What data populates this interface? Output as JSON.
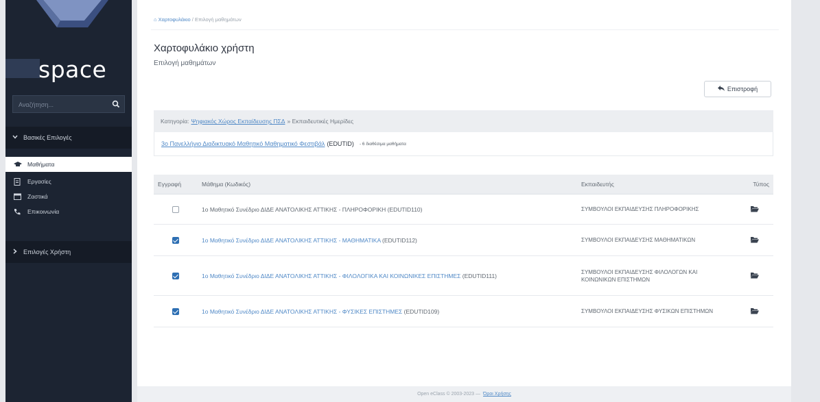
{
  "sidebar": {
    "logo_text": "space",
    "search_placeholder": "Αναζήτηση...",
    "section_basic": "Βασικές Επιλογές",
    "items": [
      {
        "label": "Μαθήματα",
        "icon": "graduation-cap-icon",
        "active": true
      },
      {
        "label": "Εργασίες",
        "icon": "file-icon",
        "active": false
      },
      {
        "label": "Ζαστικά",
        "icon": "calendar-icon",
        "active": false
      },
      {
        "label": "Επικοινωνία",
        "icon": "phone-icon",
        "active": false
      }
    ],
    "section_user": "Επιλογές Χρήστη"
  },
  "breadcrumb": {
    "home": "Χαρτοφυλάκιο",
    "separator": "/",
    "current": "Επιλογή μαθημάτων"
  },
  "page": {
    "title": "Χαρτοφυλάκιο χρήστη",
    "subtitle": "Επιλογή μαθημάτων",
    "back_label": "Επιστροφή"
  },
  "category": {
    "prefix": "Κατηγορία:",
    "link": "Ψηφιακός Χώρος Εκπαίδευσης ΠΣΔ",
    "suffix": "» Εκπαιδευτικές Ημερίδες"
  },
  "course_group": {
    "title": "3ο Πανελλήνιο Διαδικτυακό Μαθητικό Μαθηματικό Φεστιβάλ",
    "code": "(EDUTID)",
    "count": "- 6 διαθέσιμα μαθήματα"
  },
  "table": {
    "headers": [
      "Εγγραφή",
      "Μάθημα (Κωδικός)",
      "Εκπαιδευτής",
      "Τύπος"
    ],
    "rows": [
      {
        "checked": false,
        "title": "1ο Μαθητικό Συνέδριο ΔΙΔΕ ΑΝΑΤΟΛΙΚΗΣ ΑΤΤΙΚΗΣ - ΠΛΗΡΟΦΟΡΙΚΗ",
        "code": "(EDUTID110)",
        "teacher": "ΣΥΜΒΟΥΛΟΙ ΕΚΠΑΙΔΕΥΣΗΣ ΠΛΗΡΟΦΟΡΙΚΗΣ",
        "link": false
      },
      {
        "checked": true,
        "title": "1ο Μαθητικό Συνέδριο ΔΙΔΕ ΑΝΑΤΟΛΙΚΗΣ ΑΤΤΙΚΗΣ - ΜΑΘΗΜΑΤΙΚΑ",
        "code": "(EDUTID112)",
        "teacher": "ΣΥΜΒΟΥΛΟΙ ΕΚΠΑΙΔΕΥΣΗΣ ΜΑΘΗΜΑΤΙΚΩΝ",
        "link": true
      },
      {
        "checked": true,
        "title": "1ο Μαθητικό Συνέδριο ΔΙΔΕ ΑΝΑΤΟΛΙΚΗΣ ΑΤΤΙΚΗΣ - ΦΙΛΟΛΟΓΙΚΑ ΚΑΙ ΚΟΙΝΩΝΙΚΕΣ ΕΠΙΣΤΗΜΕΣ",
        "code": "(EDUTID111)",
        "teacher": "ΣΥΜΒΟΥΛΟΙ ΕΚΠΑΙΔΕΥΣΗΣ ΦΙΛΟΛΟΓΩΝ ΚΑΙ ΚΟΙΝΩΝΙΚΩΝ ΕΠΙΣΤΗΜΩΝ",
        "link": true
      },
      {
        "checked": true,
        "title": "1ο Μαθητικό Συνέδριο ΔΙΔΕ ΑΝΑΤΟΛΙΚΗΣ ΑΤΤΙΚΗΣ - ΦΥΣΙΚΕΣ ΕΠΙΣΤΗΜΕΣ",
        "code": "(EDUTID109)",
        "teacher": "ΣΥΜΒΟΥΛΟΙ ΕΚΠΑΙΔΕΥΣΗΣ ΦΥΣΙΚΩΝ ΕΠΙΣΤΗΜΩΝ",
        "link": true
      }
    ]
  },
  "footer": {
    "text": "Open eClass © 2003-2023 —",
    "link": "Όροι Χρήσης"
  },
  "colors": {
    "sidebar_bg": "#1c2432",
    "link": "#4f88c6",
    "checkbox_on": "#2e6fb3"
  }
}
